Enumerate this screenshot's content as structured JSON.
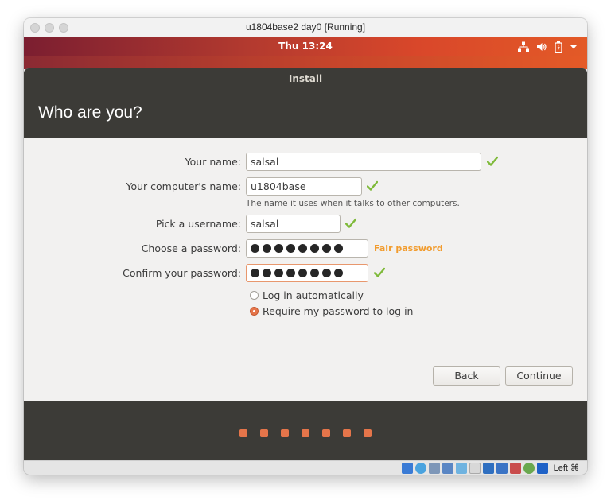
{
  "window": {
    "title": "u1804base2 day0 [Running]"
  },
  "topbar": {
    "clock": "Thu 13:24",
    "icons": [
      "network-icon",
      "volume-icon",
      "battery-icon",
      "dropdown-arrow-icon"
    ]
  },
  "installer": {
    "title": "Install",
    "heading": "Who are you?",
    "labels": {
      "name": "Your name:",
      "computer": "Your computer's name:",
      "username": "Pick a username:",
      "password": "Choose a password:",
      "confirm": "Confirm your password:"
    },
    "values": {
      "name": "salsal",
      "computer": "u1804base",
      "username": "salsal",
      "password_dots": 8,
      "confirm_dots": 8
    },
    "hint_computer": "The name it uses when it talks to other computers.",
    "password_strength": "Fair password",
    "login_options": [
      {
        "label": "Log in automatically",
        "selected": false
      },
      {
        "label": "Require my password to log in",
        "selected": true
      }
    ],
    "buttons": {
      "back": "Back",
      "continue": "Continue"
    },
    "progress_dots": 7
  },
  "vbox_status": {
    "host_key": "Left ⌘"
  },
  "colors": {
    "accent": "#e5754a",
    "header": "#3c3b37",
    "fair": "#f29c2e",
    "check": "#7fba3a"
  }
}
